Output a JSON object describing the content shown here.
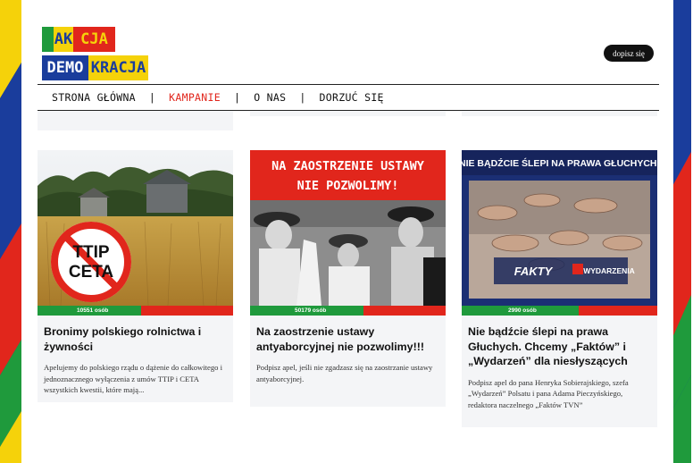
{
  "logo": {
    "line1_a": "AK",
    "line1_b": "CJA",
    "line2_a": "DEMO",
    "line2_b": "KRACJA"
  },
  "header": {
    "signup_label": "dopisz się"
  },
  "nav": {
    "items": [
      {
        "label": "STRONA GŁÓWNA",
        "active": false
      },
      {
        "label": "KAMPANIE",
        "active": true
      },
      {
        "label": "O NAS",
        "active": false
      },
      {
        "label": "DORZUĆ SIĘ",
        "active": false
      }
    ],
    "separator": "|"
  },
  "cards": [
    {
      "image_text": [
        "TTIP",
        "CETA"
      ],
      "count": "10551 osób",
      "progress": 0.53,
      "title": "Bronimy polskiego rolnictwa i żywności",
      "description": "Apelujemy do polskiego rządu o dążenie do całkowitego i jednoznacznego wyłączenia z umów TTIP i CETA wszystkich kwestii, które mają..."
    },
    {
      "image_text": [
        "NA ZAOSTRZENIE USTAWY",
        "NIE POZWOLIMY!"
      ],
      "count": "50179 osób",
      "progress": 0.58,
      "title": "Na zaostrzenie ustawy antyaborcyjnej nie pozwolimy!!!",
      "description": "Podpisz apel, jeśli nie zgadzasz się na zaostrzanie ustawy antyaborcyjnej."
    },
    {
      "image_text": [
        "NIE BĄDŹCIE ŚLEPI NA PRAWA GŁUCHYCH!",
        "FAKTY",
        "WYDARZENIA"
      ],
      "count": "2990 osób",
      "progress": 0.6,
      "title": "Nie bądźcie ślepi na prawa Głuchych. Chcemy „Faktów” i „Wydarzeń” dla niesłyszących",
      "description": "Podpisz apel do pana Henryka Sobierajskiego, szefa „Wydarzeń” Polsatu i pana Adama Pieczyńskiego, redaktora naczelnego „Faktów TVN”"
    }
  ],
  "colors": {
    "red": "#e1261c",
    "green": "#1f9a3c",
    "blue": "#1a3d9c",
    "yellow": "#f5d20a"
  }
}
